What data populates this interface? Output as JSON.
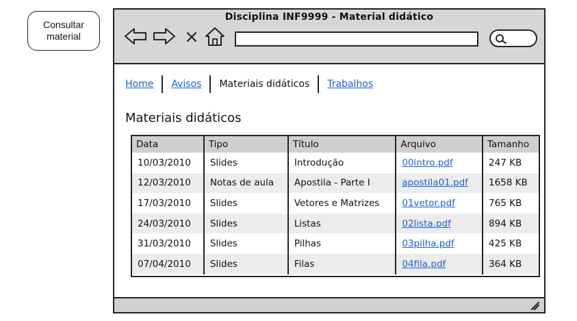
{
  "note": {
    "text": "Consultar\nmaterial"
  },
  "window": {
    "title": "Disciplina INF9999 - Material didático",
    "address_value": "",
    "icons": [
      "back-arrow-icon",
      "forward-arrow-icon",
      "stop-icon",
      "home-icon",
      "search-icon",
      "resize-grip-icon"
    ]
  },
  "nav": {
    "items": [
      {
        "label": "Home",
        "link": true
      },
      {
        "label": "Avisos",
        "link": true
      },
      {
        "label": "Materiais didáticos",
        "link": false
      },
      {
        "label": "Trabalhos",
        "link": true
      }
    ]
  },
  "page": {
    "heading": "Materiais didáticos"
  },
  "table": {
    "columns": [
      "Data",
      "Tipo",
      "Título",
      "Arquivo",
      "Tamanho"
    ],
    "rows": [
      {
        "data": "10/03/2010",
        "tipo": "Slides",
        "titulo": "Introdução",
        "arquivo": "00intro.pdf",
        "tamanho": "247 KB"
      },
      {
        "data": "12/03/2010",
        "tipo": "Notas de aula",
        "titulo": "Apostila - Parte I",
        "arquivo": "apostila01.pdf",
        "tamanho": "1658 KB"
      },
      {
        "data": "17/03/2010",
        "tipo": "Slides",
        "titulo": "Vetores e Matrizes",
        "arquivo": "01vetor.pdf",
        "tamanho": "765 KB"
      },
      {
        "data": "24/03/2010",
        "tipo": "Slides",
        "titulo": "Listas",
        "arquivo": "02lista.pdf",
        "tamanho": "894 KB"
      },
      {
        "data": "31/03/2010",
        "tipo": "Slides",
        "titulo": "Pilhas",
        "arquivo": "03pilha.pdf",
        "tamanho": "425 KB"
      },
      {
        "data": "07/04/2010",
        "tipo": "Slides",
        "titulo": "Filas",
        "arquivo": "04fila.pdf",
        "tamanho": "364 KB"
      }
    ]
  },
  "colors": {
    "link": "#1a5fd6",
    "chrome": "#d6d6d6",
    "row_alt": "#ececec",
    "header": "#cfcfcf"
  }
}
